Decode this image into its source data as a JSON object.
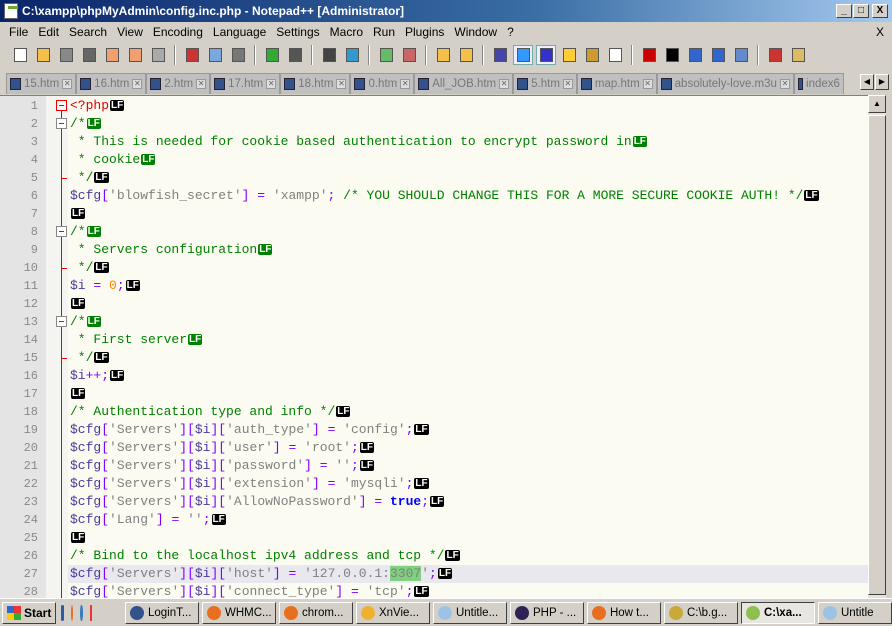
{
  "window": {
    "title": "C:\\xampp\\phpMyAdmin\\config.inc.php - Notepad++ [Administrator]",
    "min": "_",
    "max": "□",
    "close": "X"
  },
  "menu": {
    "items": [
      "File",
      "Edit",
      "Search",
      "View",
      "Encoding",
      "Language",
      "Settings",
      "Macro",
      "Run",
      "Plugins",
      "Window",
      "?"
    ],
    "close": "X"
  },
  "toolbar": {
    "icons": [
      "new-file",
      "open-file",
      "save",
      "save-all",
      "close",
      "close-all",
      "print",
      "|",
      "cut",
      "copy",
      "paste",
      "|",
      "undo",
      "redo",
      "|",
      "find",
      "replace",
      "|",
      "zoom-in",
      "zoom-out",
      "|",
      "sync-vertical",
      "sync-horizontal",
      "|",
      "word-wrap",
      "show-all-chars",
      "indent-guide",
      "udl",
      "doc-map",
      "function-list",
      "|",
      "record-macro",
      "stop-record",
      "play-macro",
      "run-macro-multiple",
      "save-macro",
      "|",
      "spell-check",
      "clipboard"
    ],
    "active": [
      "show-all-chars",
      "indent-guide"
    ]
  },
  "tabs": [
    "15.htm",
    "16.htm",
    "2.htm",
    "17.htm",
    "18.htm",
    "0.htm",
    "All_JOB.htm",
    "5.htm",
    "map.htm",
    "absolutely-love.m3u",
    "index6"
  ],
  "editor": {
    "lines": [
      {
        "n": "1",
        "text": "<?php",
        "eol": "LF",
        "fold": "open"
      },
      {
        "n": "2",
        "text": "/*",
        "eol": "LF",
        "fold": "open",
        "eolc": "g"
      },
      {
        "n": "3",
        "text": " * This is needed for cookie based authentication to encrypt password in",
        "eol": "LF",
        "eolc": "g"
      },
      {
        "n": "4",
        "text": " * cookie",
        "eol": "LF",
        "eolc": "g"
      },
      {
        "n": "5",
        "text": " */",
        "eol": "LF",
        "fold": "end"
      },
      {
        "n": "6",
        "text": "$cfg['blowfish_secret'] = 'xampp'; /* YOU SHOULD CHANGE THIS FOR A MORE SECURE COOKIE AUTH! */",
        "eol": "LF"
      },
      {
        "n": "7",
        "text": "",
        "eol": "LF"
      },
      {
        "n": "8",
        "text": "/*",
        "eol": "LF",
        "fold": "open",
        "eolc": "g"
      },
      {
        "n": "9",
        "text": " * Servers configuration",
        "eol": "LF",
        "eolc": "g"
      },
      {
        "n": "10",
        "text": " */",
        "eol": "LF",
        "fold": "end"
      },
      {
        "n": "11",
        "text": "$i = 0;",
        "eol": "LF"
      },
      {
        "n": "12",
        "text": "",
        "eol": "LF"
      },
      {
        "n": "13",
        "text": "/*",
        "eol": "LF",
        "fold": "open",
        "eolc": "g"
      },
      {
        "n": "14",
        "text": " * First server",
        "eol": "LF",
        "eolc": "g"
      },
      {
        "n": "15",
        "text": " */",
        "eol": "LF",
        "fold": "end"
      },
      {
        "n": "16",
        "text": "$i++;",
        "eol": "LF"
      },
      {
        "n": "17",
        "text": "",
        "eol": "LF"
      },
      {
        "n": "18",
        "text": "/* Authentication type and info */",
        "eol": "LF"
      },
      {
        "n": "19",
        "text": "$cfg['Servers'][$i]['auth_type'] = 'config';",
        "eol": "LF"
      },
      {
        "n": "20",
        "text": "$cfg['Servers'][$i]['user'] = 'root';",
        "eol": "LF"
      },
      {
        "n": "21",
        "text": "$cfg['Servers'][$i]['password'] = '';",
        "eol": "LF"
      },
      {
        "n": "22",
        "text": "$cfg['Servers'][$i]['extension'] = 'mysqli';",
        "eol": "LF"
      },
      {
        "n": "23",
        "text": "$cfg['Servers'][$i]['AllowNoPassword'] = true;",
        "eol": "LF"
      },
      {
        "n": "24",
        "text": "$cfg['Lang'] = '';",
        "eol": "LF"
      },
      {
        "n": "25",
        "text": "",
        "eol": "LF"
      },
      {
        "n": "26",
        "text": "/* Bind to the localhost ipv4 address and tcp */",
        "eol": "LF"
      },
      {
        "n": "27",
        "text": "$cfg['Servers'][$i]['host'] = '127.0.0.1:3307';",
        "eol": "LF",
        "current": true,
        "highlight": "3307"
      },
      {
        "n": "28",
        "text": "$cfg['Servers'][$i]['connect_type'] = 'tcp';",
        "eol": "LF"
      }
    ]
  },
  "taskbar": {
    "start": "Start",
    "tasks": [
      {
        "label": "LoginT...",
        "color": "#33518a"
      },
      {
        "label": "WHMC...",
        "color": "#e76f1f"
      },
      {
        "label": "chrom...",
        "color": "#e76f1f"
      },
      {
        "label": "XnVie...",
        "color": "#f0b030"
      },
      {
        "label": "Untitle...",
        "color": "#9cc3e6"
      },
      {
        "label": "PHP - ...",
        "color": "#2c2255"
      },
      {
        "label": "How t...",
        "color": "#e76f1f"
      },
      {
        "label": "C:\\b.g...",
        "color": "#c9a93a"
      },
      {
        "label": "C:\\xa...",
        "color": "#8fbf4f",
        "active": true
      },
      {
        "label": "Untitle",
        "color": "#9cc3e6"
      }
    ]
  }
}
